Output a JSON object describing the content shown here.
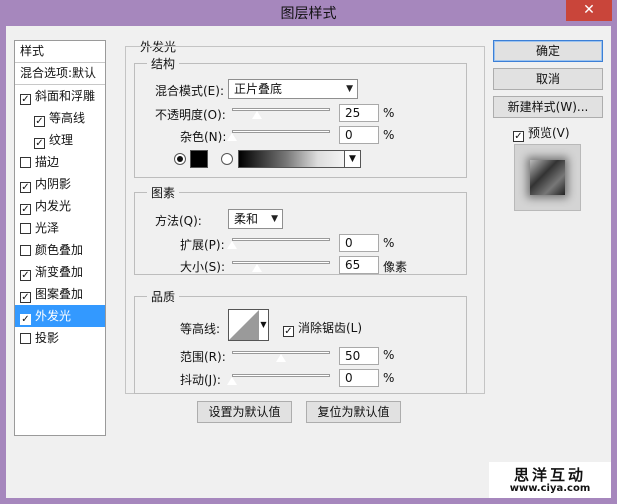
{
  "window": {
    "title": "图层样式",
    "close_glyph": "✕"
  },
  "left_panel": {
    "header": "样式",
    "blend_options": "混合选项:默认",
    "items": [
      {
        "label": "斜面和浮雕",
        "checked": true,
        "indent": false,
        "selected": false
      },
      {
        "label": "等高线",
        "checked": true,
        "indent": true,
        "selected": false
      },
      {
        "label": "纹理",
        "checked": true,
        "indent": true,
        "selected": false
      },
      {
        "label": "描边",
        "checked": false,
        "indent": false,
        "selected": false
      },
      {
        "label": "内阴影",
        "checked": true,
        "indent": false,
        "selected": false
      },
      {
        "label": "内发光",
        "checked": true,
        "indent": false,
        "selected": false
      },
      {
        "label": "光泽",
        "checked": false,
        "indent": false,
        "selected": false
      },
      {
        "label": "颜色叠加",
        "checked": false,
        "indent": false,
        "selected": false
      },
      {
        "label": "渐变叠加",
        "checked": true,
        "indent": false,
        "selected": false
      },
      {
        "label": "图案叠加",
        "checked": true,
        "indent": false,
        "selected": false
      },
      {
        "label": "外发光",
        "checked": true,
        "indent": false,
        "selected": true
      },
      {
        "label": "投影",
        "checked": false,
        "indent": false,
        "selected": false
      }
    ]
  },
  "main": {
    "section_title": "外发光",
    "structure": {
      "title": "结构",
      "blend_mode_label": "混合模式(E):",
      "blend_mode_value": "正片叠底",
      "opacity_label": "不透明度(O):",
      "opacity_value": "25",
      "opacity_unit": "%",
      "opacity_level": 0.25,
      "noise_label": "杂色(N):",
      "noise_value": "0",
      "noise_unit": "%",
      "noise_level": 0.0,
      "color_swatch": "#000000"
    },
    "elements": {
      "title": "图素",
      "technique_label": "方法(Q):",
      "technique_value": "柔和",
      "spread_label": "扩展(P):",
      "spread_value": "0",
      "spread_unit": "%",
      "spread_level": 0.0,
      "size_label": "大小(S):",
      "size_value": "65",
      "size_unit": "像素",
      "size_level": 0.26
    },
    "quality": {
      "title": "品质",
      "contour_label": "等高线:",
      "anti_alias_label": "消除锯齿(L)",
      "anti_alias_checked": true,
      "range_label": "范围(R):",
      "range_value": "50",
      "range_unit": "%",
      "range_level": 0.5,
      "jitter_label": "抖动(J):",
      "jitter_value": "0",
      "jitter_unit": "%",
      "jitter_level": 0.0
    },
    "make_default": "设置为默认值",
    "reset_default": "复位为默认值"
  },
  "right_panel": {
    "ok": "确定",
    "cancel": "取消",
    "new_style": "新建样式(W)...",
    "preview_label": "预览(V)",
    "preview_checked": true
  },
  "watermark": {
    "brand": "思洋互动",
    "url": "www.ciya.com"
  }
}
